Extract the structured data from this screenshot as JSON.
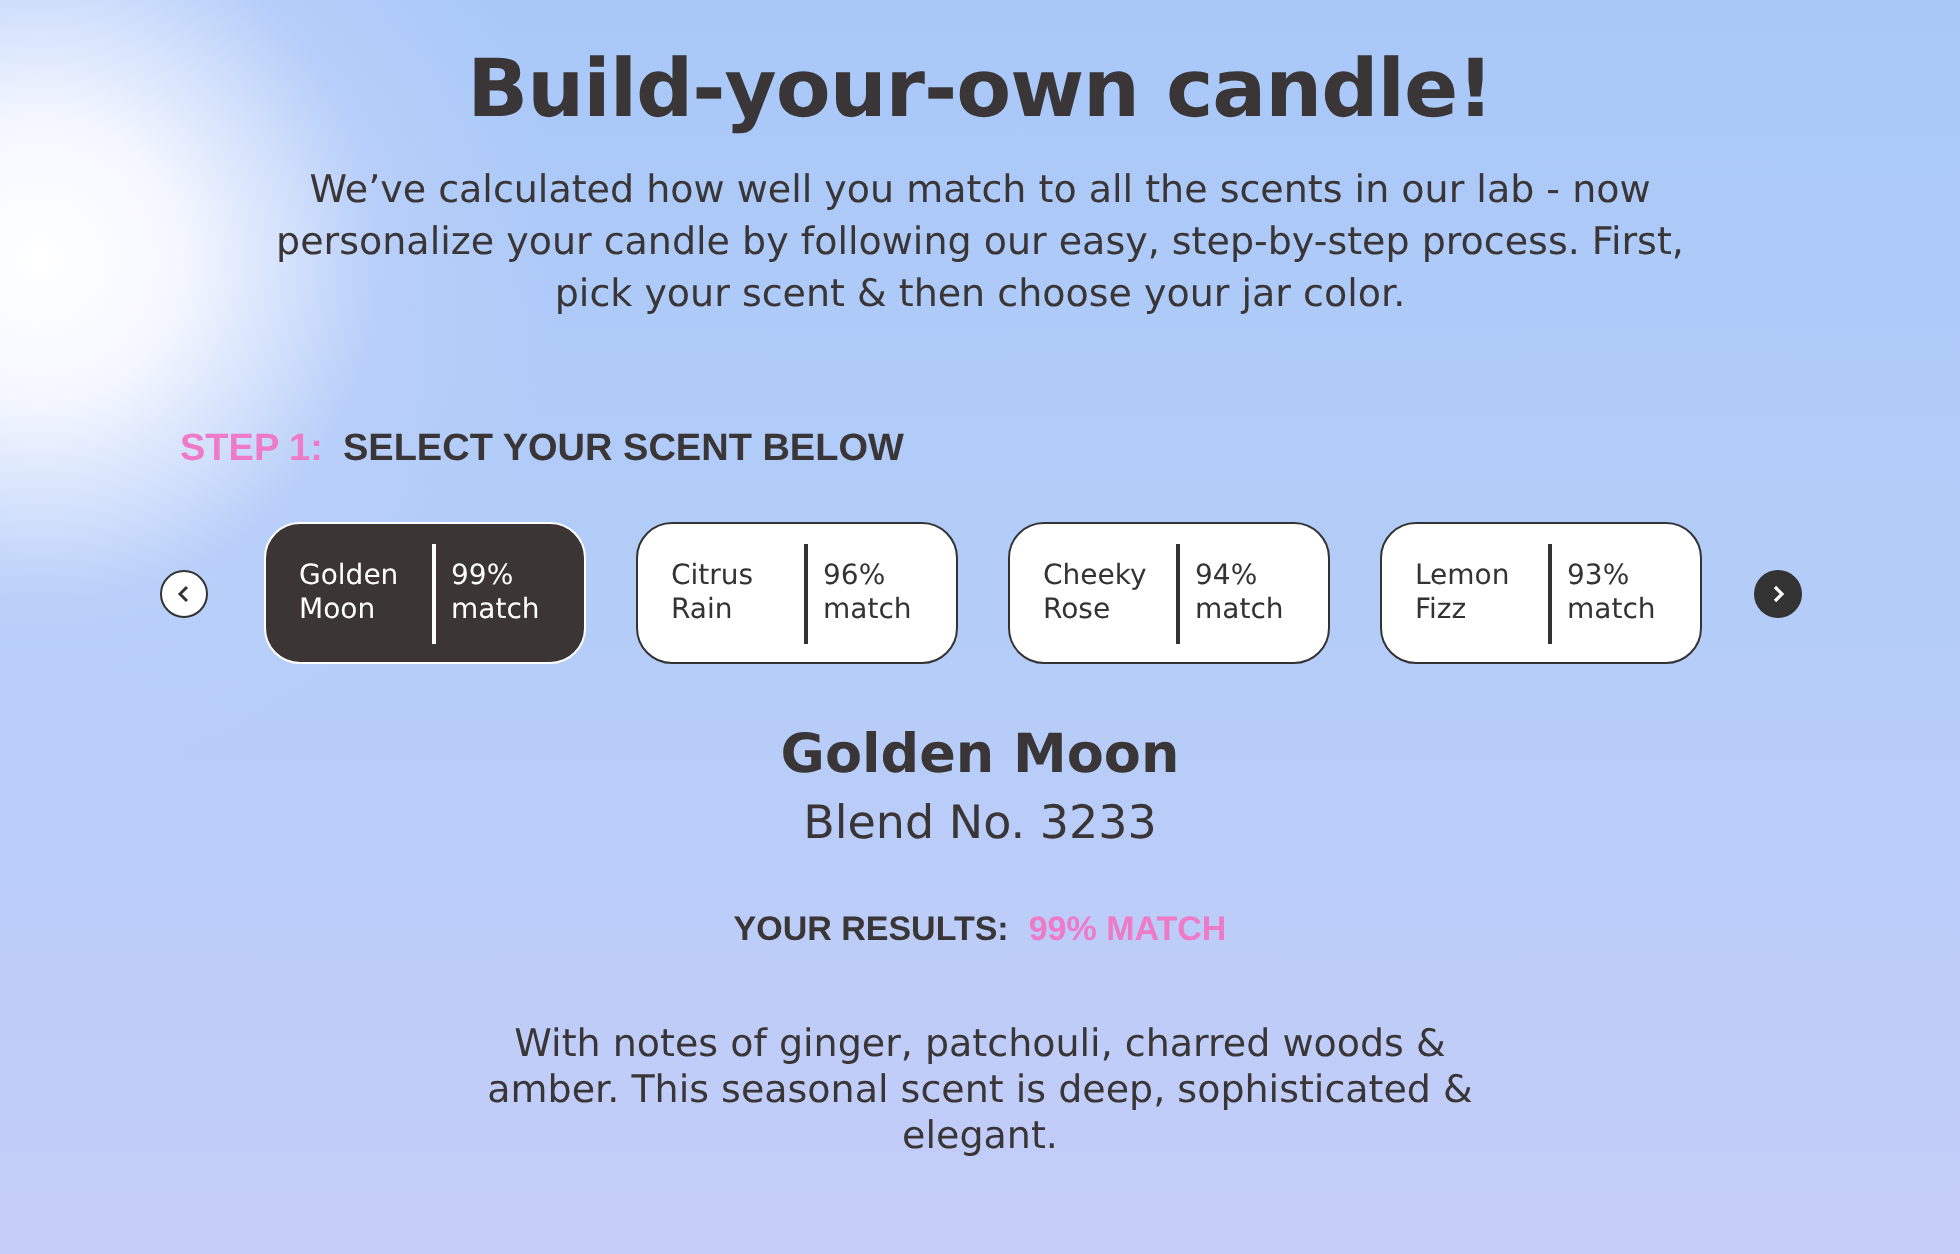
{
  "title": "Build-your-own candle!",
  "intro": "We’ve calculated how well you match to all the scents in our lab - now personalize your candle by following our easy, step-by-step process. First, pick your scent & then choose your jar color.",
  "step": {
    "number": "STEP 1:",
    "label": "SELECT YOUR SCENT BELOW"
  },
  "scents": [
    {
      "name": "Golden Moon",
      "match": "99% match",
      "selected": true
    },
    {
      "name": "Citrus Rain",
      "match": "96% match",
      "selected": false
    },
    {
      "name": "Cheeky Rose",
      "match": "94% match",
      "selected": false
    },
    {
      "name": "Lemon Fizz",
      "match": "93% match",
      "selected": false
    }
  ],
  "detail": {
    "name": "Golden Moon",
    "blend": "Blend No. 3233",
    "results_label": "YOUR RESULTS:",
    "results_value": "99% MATCH",
    "description": "With notes of ginger, patchouli, charred woods & amber. This seasonal scent is deep, sophisticated & elegant."
  }
}
